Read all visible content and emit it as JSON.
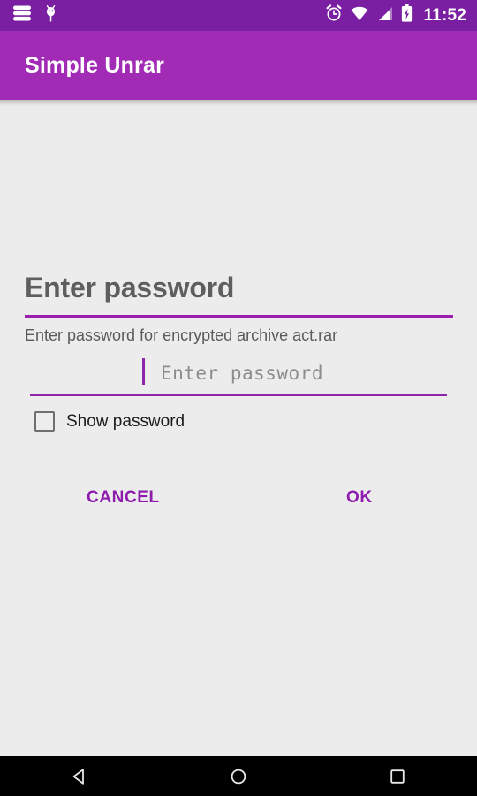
{
  "status_bar": {
    "background_color": "#7B1FA2",
    "time": "11:52",
    "left_icons": [
      {
        "name": "notification-stack-icon",
        "glyph": "stack"
      },
      {
        "name": "debug-bug-icon",
        "glyph": "bug"
      }
    ],
    "right_icons": [
      {
        "name": "alarm-clock-icon",
        "glyph": "alarm"
      },
      {
        "name": "wifi-icon",
        "glyph": "wifi"
      },
      {
        "name": "cellular-signal-icon",
        "glyph": "signal"
      },
      {
        "name": "battery-charging-icon",
        "glyph": "battery-charging"
      }
    ]
  },
  "app_bar": {
    "title": "Simple Unrar",
    "background_color": "#A12BB5",
    "title_color": "#FFFFFF"
  },
  "dialog": {
    "title": "Enter password",
    "message": "Enter password for encrypted archive act.rar",
    "accent_color": "#8E24AA",
    "password_input": {
      "value": "",
      "placeholder": "Enter password",
      "caret_visible": true
    },
    "show_password": {
      "label": "Show password",
      "checked": false
    },
    "buttons": {
      "cancel_label": "CANCEL",
      "ok_label": "OK",
      "color": "#8E1BAE"
    }
  },
  "nav_bar": {
    "background_color": "#000000",
    "buttons": [
      {
        "name": "back-button",
        "glyph": "triangle-left"
      },
      {
        "name": "home-button",
        "glyph": "circle"
      },
      {
        "name": "recents-button",
        "glyph": "square"
      }
    ]
  }
}
